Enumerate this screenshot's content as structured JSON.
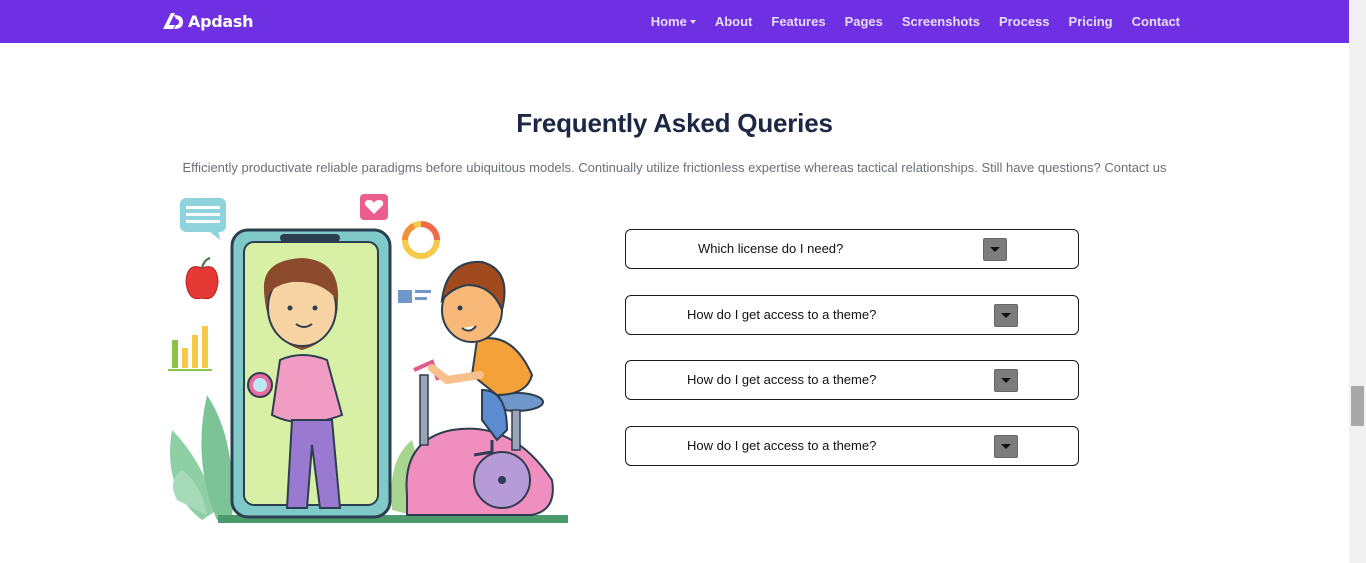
{
  "brand": {
    "name": "Apdash"
  },
  "nav": {
    "items": [
      {
        "label": "Home",
        "has_dropdown": true
      },
      {
        "label": "About"
      },
      {
        "label": "Features"
      },
      {
        "label": "Pages"
      },
      {
        "label": "Screenshots"
      },
      {
        "label": "Process"
      },
      {
        "label": "Pricing"
      },
      {
        "label": "Contact"
      }
    ]
  },
  "faq": {
    "title": "Frequently Asked Queries",
    "subtitle": "Efficiently productivate reliable paradigms before ubiquitous models. Continually utilize frictionless expertise whereas tactical relationships. Still have questions?",
    "contact_link": "Contact us",
    "questions": [
      {
        "text": "Which license do I need?"
      },
      {
        "text": "How do I get access to a theme?"
      },
      {
        "text": "How do I get access to a theme?"
      },
      {
        "text": "How do I get access to a theme?"
      }
    ]
  },
  "colors": {
    "navbar": "#6f2fe3",
    "title": "#1c2744",
    "toggle": "#7d7d7d"
  }
}
